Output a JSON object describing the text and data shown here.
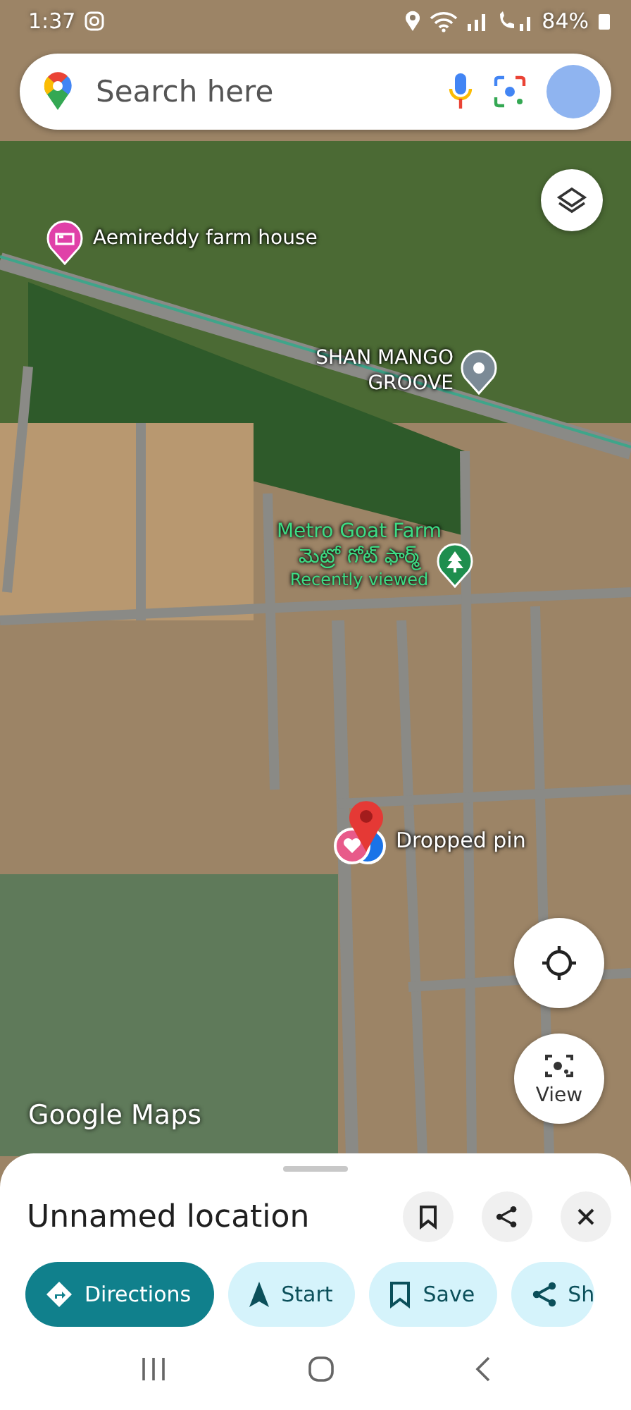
{
  "status_bar": {
    "time": "1:37",
    "battery": "84%"
  },
  "search": {
    "placeholder": "Search here"
  },
  "map": {
    "places": [
      {
        "kind": "hotel",
        "name": "Aemireddy farm house"
      },
      {
        "kind": "place",
        "name": "SHAN MANGO GROOVE"
      },
      {
        "kind": "park",
        "name": "Metro Goat Farm",
        "local_name": "మెట్రో గోట్ ఫార్మ్",
        "note": "Recently viewed"
      }
    ],
    "dropped_pin": {
      "label": "Dropped pin"
    },
    "view_button": {
      "label": "View"
    },
    "attribution": "Google Maps"
  },
  "place_sheet": {
    "title": "Unnamed location",
    "actions": [
      {
        "kind": "directions",
        "label": "Directions"
      },
      {
        "kind": "start",
        "label": "Start"
      },
      {
        "kind": "save",
        "label": "Save"
      },
      {
        "kind": "share",
        "label": "Sh"
      }
    ]
  }
}
